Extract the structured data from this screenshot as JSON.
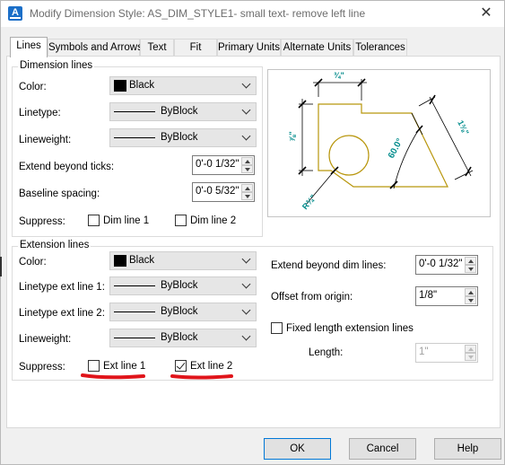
{
  "window": {
    "title": "Modify Dimension Style: AS_DIM_STYLE1- small text- remove left line",
    "app_icon": "A",
    "close_glyph": "✕"
  },
  "tabs": [
    {
      "label": "Lines",
      "active": true
    },
    {
      "label": "Symbols and Arrows",
      "active": false
    },
    {
      "label": "Text",
      "active": false
    },
    {
      "label": "Fit",
      "active": false
    },
    {
      "label": "Primary Units",
      "active": false
    },
    {
      "label": "Alternate Units",
      "active": false
    },
    {
      "label": "Tolerances",
      "active": false
    }
  ],
  "dimension_lines": {
    "group_label": "Dimension lines",
    "color": {
      "label": "Color:",
      "value": "Black"
    },
    "linetype": {
      "label": "Linetype:",
      "value": "ByBlock"
    },
    "lineweight": {
      "label": "Lineweight:",
      "value": "ByBlock"
    },
    "extend_beyond_ticks": {
      "label": "Extend beyond ticks:",
      "value": "0'-0 1/32\""
    },
    "baseline_spacing": {
      "label": "Baseline spacing:",
      "value": "0'-0 5/32\""
    },
    "suppress": {
      "label": "Suppress:",
      "dim_line_1": {
        "label": "Dim line 1",
        "checked": false
      },
      "dim_line_2": {
        "label": "Dim line 2",
        "checked": false
      }
    }
  },
  "extension_lines": {
    "group_label": "Extension lines",
    "color": {
      "label": "Color:",
      "value": "Black"
    },
    "linetype_ext_line_1": {
      "label": "Linetype ext line 1:",
      "value": "ByBlock"
    },
    "linetype_ext_line_2": {
      "label": "Linetype ext line 2:",
      "value": "ByBlock"
    },
    "lineweight": {
      "label": "Lineweight:",
      "value": "ByBlock"
    },
    "suppress": {
      "label": "Suppress:",
      "ext_line_1": {
        "label": "Ext line 1",
        "checked": false
      },
      "ext_line_2": {
        "label": "Ext line 2",
        "checked": true
      }
    },
    "extend_beyond_dim_lines": {
      "label": "Extend beyond dim lines:",
      "value": "0'-0 1/32\""
    },
    "offset_from_origin": {
      "label": "Offset from origin:",
      "value": "1/8\""
    },
    "fixed_length": {
      "label": "Fixed length extension lines",
      "checked": false
    },
    "length": {
      "label": "Length:",
      "value": "1\""
    }
  },
  "preview": {
    "dim_top": "¾\"",
    "dim_left": "⅞\"",
    "dim_right": "1⅜\"",
    "dim_angle": "60.0°",
    "dim_radius": "R¾\"",
    "annotation_color": "#008b8b",
    "shape_color": "#b8960c"
  },
  "buttons": {
    "ok": "OK",
    "cancel": "Cancel",
    "help": "Help"
  },
  "annotation": {
    "highlight_color": "#e0141a"
  }
}
